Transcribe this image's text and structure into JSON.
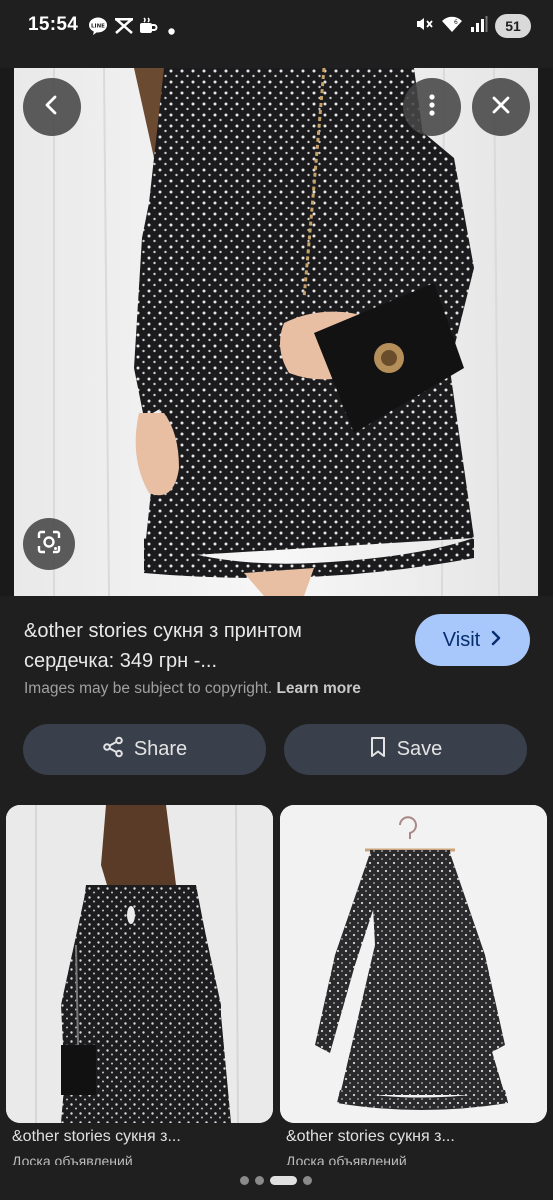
{
  "status_bar": {
    "time": "15:54",
    "battery": "51",
    "notification_icons": [
      "line-icon",
      "app-icon",
      "coffee-icon",
      "dot-icon"
    ],
    "system_icons": [
      "mute-icon",
      "wifi-icon",
      "signal-icon",
      "battery-icon"
    ]
  },
  "hero": {
    "buttons": [
      "back-icon",
      "more-icon",
      "close-icon",
      "lens-icon"
    ]
  },
  "result": {
    "title": "&other stories сукня з принтом сердечка: 349 грн -...",
    "visit_label": "Visit",
    "copyright_text": "Images may be subject to copyright.",
    "learn_more": "Learn more",
    "share_label": "Share",
    "save_label": "Save"
  },
  "related": [
    {
      "caption": "&other stories сукня з...",
      "source": "Доска объявлений"
    },
    {
      "caption": "&other stories сукня з...",
      "source": "Доска объявлений"
    }
  ],
  "pager": {
    "count": 4,
    "active": 2
  }
}
